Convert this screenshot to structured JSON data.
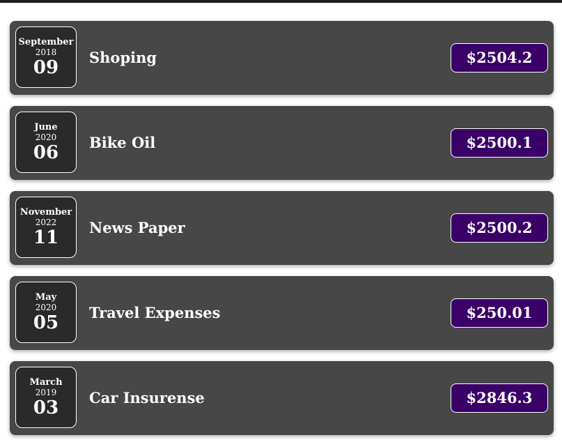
{
  "expenses": [
    {
      "month": "September",
      "year": "2018",
      "day": "09",
      "title": "Shoping",
      "amount": "$2504.2"
    },
    {
      "month": "June",
      "year": "2020",
      "day": "06",
      "title": "Bike Oil",
      "amount": "$2500.1"
    },
    {
      "month": "November",
      "year": "2022",
      "day": "11",
      "title": "News Paper",
      "amount": "$2500.2"
    },
    {
      "month": "May",
      "year": "2020",
      "day": "05",
      "title": "Travel Expenses",
      "amount": "$250.01"
    },
    {
      "month": "March",
      "year": "2019",
      "day": "03",
      "title": "Car Insurense",
      "amount": "$2846.3"
    }
  ],
  "colors": {
    "card_background": "#474747",
    "date_background": "#2a2a2a",
    "amount_background": "#3a0068",
    "text": "#ffffff"
  }
}
